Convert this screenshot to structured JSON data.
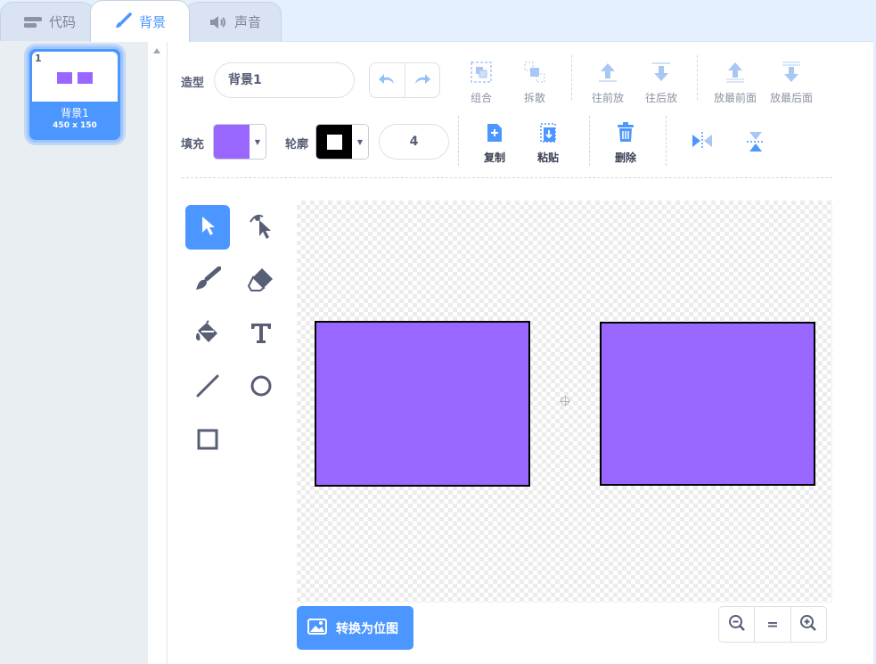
{
  "tabs": [
    {
      "label": "代码",
      "icon": "code-blocks-icon"
    },
    {
      "label": "背景",
      "icon": "paintbrush-icon",
      "active": true
    },
    {
      "label": "声音",
      "icon": "speaker-icon"
    }
  ],
  "costume": {
    "number": "1",
    "name": "背景1",
    "size": "450 x 150"
  },
  "toolbar": {
    "costume_label": "造型",
    "costume_name": "背景1",
    "group_label": "组合",
    "ungroup_label": "拆散",
    "forward_label": "往前放",
    "backward_label": "往后放",
    "front_label": "放最前面",
    "back_label": "放最后面",
    "fill_label": "填充",
    "outline_label": "轮廓",
    "outline_width": "4",
    "copy_label": "复制",
    "paste_label": "粘贴",
    "delete_label": "删除"
  },
  "colors": {
    "fill": "#9966ff",
    "outline": "#000000",
    "accent": "#4c97ff"
  },
  "canvas": {
    "shapes": [
      "rectangle",
      "rectangle"
    ]
  },
  "bottom": {
    "bitmap_label": "转换为位图",
    "zoom_reset": "="
  }
}
